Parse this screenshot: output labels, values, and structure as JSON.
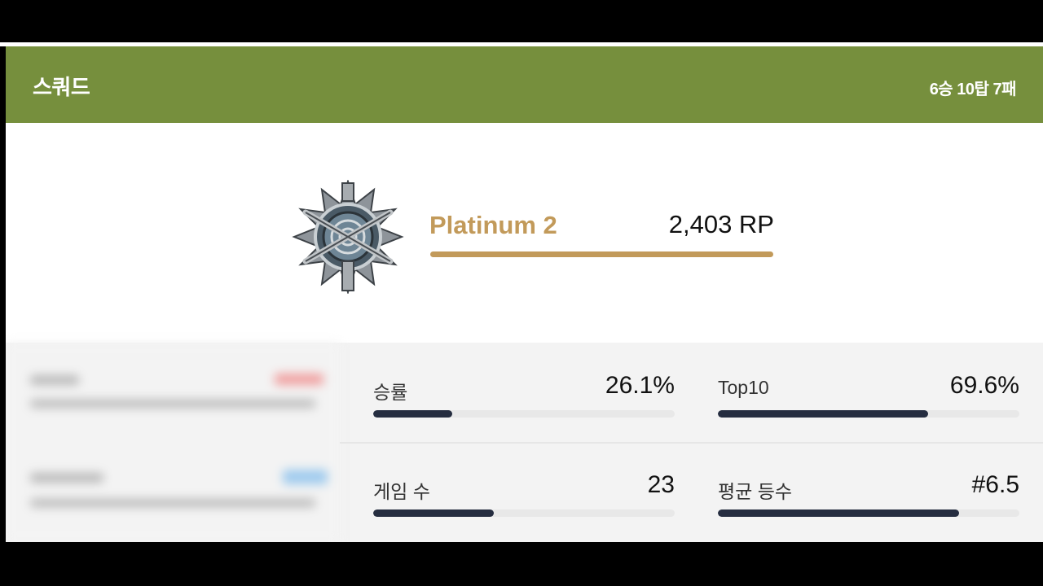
{
  "header": {
    "title": "스쿼드",
    "record": "6승 10탑 7패"
  },
  "rank": {
    "tier": "Platinum 2",
    "rp": "2,403 RP",
    "emblem_icon": "platinum-rank-emblem-icon",
    "accent_color": "#c29a5a"
  },
  "stats": [
    {
      "label": "승률",
      "value": "26.1%",
      "fill": 0.261
    },
    {
      "label": "Top10",
      "value": "69.6%",
      "fill": 0.696
    },
    {
      "label": "게임 수",
      "value": "23",
      "fill": 0.4
    },
    {
      "label": "평균 등수",
      "value": "#6.5",
      "fill": 0.8
    }
  ],
  "colors": {
    "header_bg": "#768f3d",
    "bar_fill": "#252d40",
    "bar_track": "#e8e8e8"
  }
}
